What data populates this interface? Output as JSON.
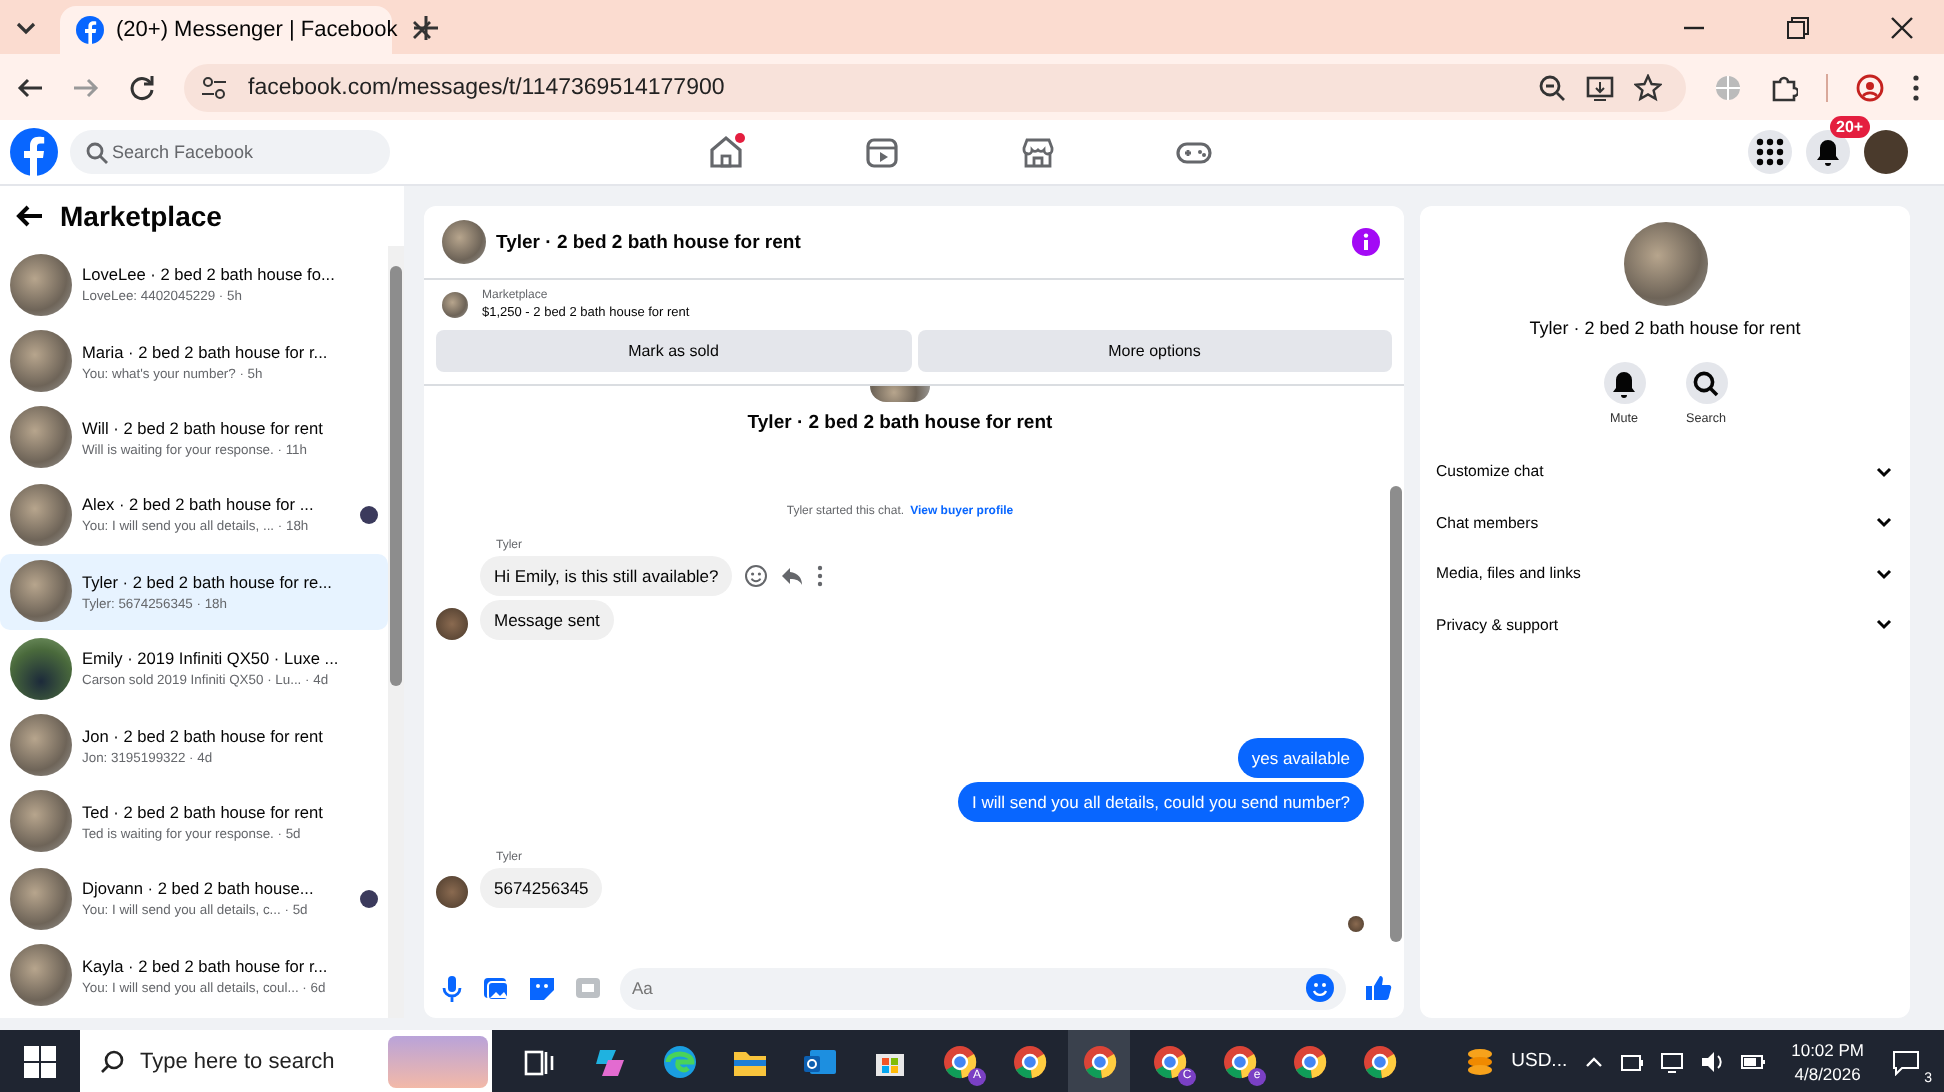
{
  "browser": {
    "tab_title": "(20+) Messenger | Facebook",
    "url": "facebook.com/messages/t/1147369514177900"
  },
  "topnav": {
    "search_placeholder": "Search Facebook",
    "notification_count": "20+",
    "nav": [
      {
        "kind": "home",
        "notified": true
      },
      {
        "kind": "video",
        "notified": false
      },
      {
        "kind": "marketplace",
        "notified": false
      },
      {
        "kind": "gaming",
        "notified": false
      }
    ]
  },
  "sidebar": {
    "title": "Marketplace",
    "conversations": [
      {
        "title": "LoveLee · 2 bed 2 bath house fo...",
        "preview": "LoveLee: 4402045229 · 5h",
        "kind": "house",
        "selected": false,
        "seen": false
      },
      {
        "title": "Maria · 2 bed 2 bath house for r...",
        "preview": "You: what's your number? · 5h",
        "kind": "house",
        "selected": false,
        "seen": false
      },
      {
        "title": "Will · 2 bed 2 bath house for rent",
        "preview": "Will is waiting for your response. · 11h",
        "kind": "house",
        "selected": false,
        "seen": false
      },
      {
        "title": "Alex · 2 bed 2 bath house for ...",
        "preview": "You: I will send you all details, ... · 18h",
        "kind": "house",
        "selected": false,
        "seen": true
      },
      {
        "title": "Tyler · 2 bed 2 bath house for re...",
        "preview": "Tyler: 5674256345 · 18h",
        "kind": "house",
        "selected": true,
        "seen": false
      },
      {
        "title": "Emily · 2019 Infiniti QX50 · Luxe ...",
        "preview": "Carson sold 2019 Infiniti QX50 · Lu... · 4d",
        "kind": "car",
        "selected": false,
        "seen": false
      },
      {
        "title": "Jon · 2 bed 2 bath house for rent",
        "preview": "Jon: 3195199322 · 4d",
        "kind": "house",
        "selected": false,
        "seen": false
      },
      {
        "title": "Ted · 2 bed 2 bath house for rent",
        "preview": "Ted is waiting for your response. · 5d",
        "kind": "house",
        "selected": false,
        "seen": false
      },
      {
        "title": "Djovann · 2 bed 2 bath house...",
        "preview": "You: I will send you all details, c... · 5d",
        "kind": "house",
        "selected": false,
        "seen": true
      },
      {
        "title": "Kayla · 2 bed 2 bath house for r...",
        "preview": "You: I will send you all details, coul... · 6d",
        "kind": "house",
        "selected": false,
        "seen": false
      }
    ]
  },
  "chat": {
    "title": "Tyler · 2 bed 2 bath house for rent",
    "listing": {
      "label": "Marketplace",
      "text": "$1,250 - 2 bed 2 bath house for rent"
    },
    "buttons": [
      "Mark as sold",
      "More options"
    ],
    "intro_title": "Tyler · 2 bed 2 bath house for rent",
    "system_text": "Tyler started this chat.",
    "system_link": "View buyer profile",
    "groups": [
      {
        "kind": "incoming",
        "sender": "Tyler",
        "messages": [
          {
            "text": "Hi Emily, is this still available?",
            "actions": true
          },
          {
            "text": "Message sent",
            "actions": false
          }
        ]
      },
      {
        "kind": "outgoing",
        "messages": [
          {
            "text": "yes available",
            "actions": false
          },
          {
            "text": "I will send you all details, could you send number?",
            "actions": false
          }
        ]
      },
      {
        "kind": "incoming",
        "sender": "Tyler",
        "messages": [
          {
            "text": "5674256345",
            "actions": false
          }
        ]
      }
    ],
    "composer_placeholder": "Aa"
  },
  "details": {
    "title": "Tyler · 2 bed 2 bath house for rent",
    "actions": [
      {
        "kind": "mute",
        "label": "Mute"
      },
      {
        "kind": "search",
        "label": "Search"
      }
    ],
    "sections": [
      "Customize chat",
      "Chat members",
      "Media, files and links",
      "Privacy & support"
    ]
  },
  "taskbar": {
    "search_placeholder": "Type here to search",
    "apps": [
      {
        "kind": "taskview",
        "selected": false
      },
      {
        "kind": "copilot",
        "selected": false
      },
      {
        "kind": "edge",
        "selected": false
      },
      {
        "kind": "explorer",
        "selected": false
      },
      {
        "kind": "outlook",
        "selected": false
      },
      {
        "kind": "store",
        "selected": false
      },
      {
        "kind": "chrome",
        "badge": "A",
        "selected": false
      },
      {
        "kind": "chrome",
        "selected": false
      },
      {
        "kind": "chrome",
        "selected": true
      },
      {
        "kind": "chrome",
        "badge": "C",
        "selected": false
      },
      {
        "kind": "chrome",
        "badge": "e",
        "selected": false
      },
      {
        "kind": "chrome",
        "selected": false
      },
      {
        "kind": "chrome",
        "selected": false
      }
    ],
    "currency": "USD...",
    "time": "10:02 PM",
    "date": "4/8/2026",
    "notifications": "3"
  }
}
